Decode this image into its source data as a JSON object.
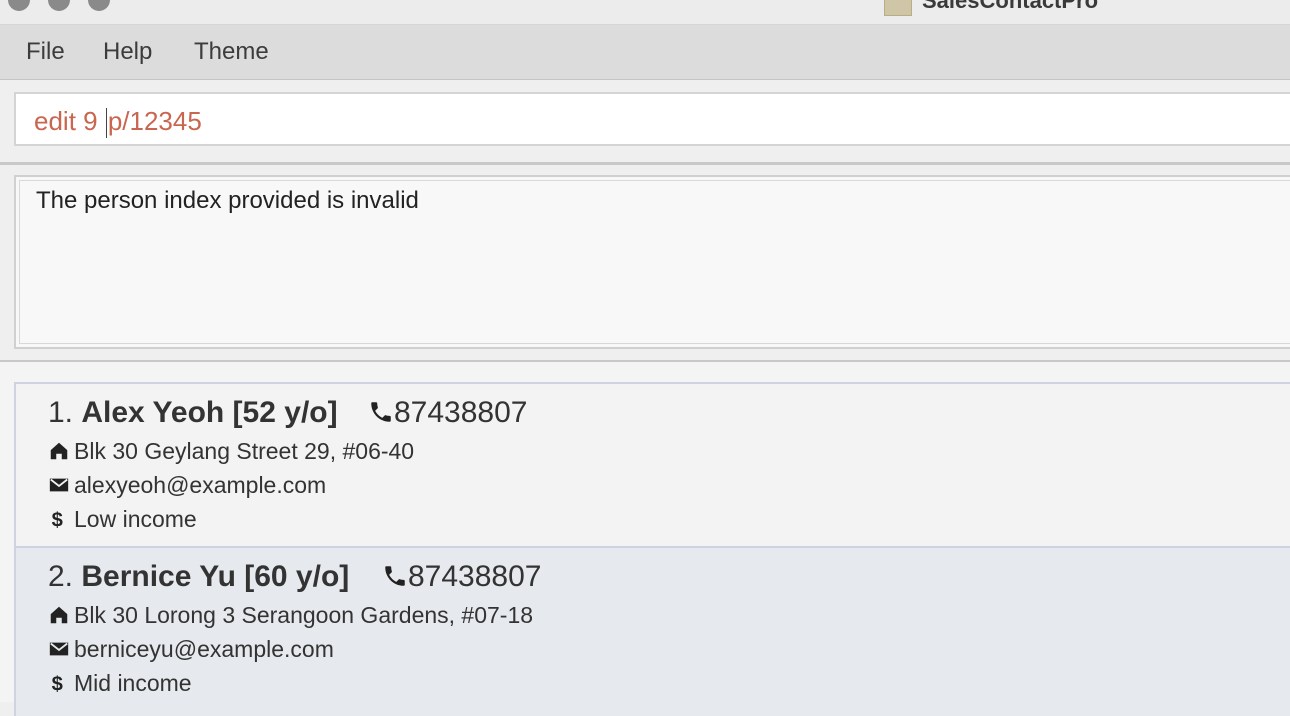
{
  "window": {
    "title": "SalesContactPro"
  },
  "menu": {
    "file": "File",
    "help": "Help",
    "theme": "Theme"
  },
  "command": {
    "value": "edit 9 p/12345"
  },
  "result": {
    "message": "The person index provided is invalid"
  },
  "persons": [
    {
      "index": "1.",
      "name": "Alex Yeoh [52 y/o]",
      "phone": "87438807",
      "address": "Blk 30 Geylang Street 29, #06-40",
      "email": "alexyeoh@example.com",
      "income": "Low income"
    },
    {
      "index": "2.",
      "name": "Bernice Yu [60 y/o]",
      "phone": "87438807",
      "address": "Blk 30 Lorong 3 Serangoon Gardens, #07-18",
      "email": "berniceyu@example.com",
      "income": "Mid income"
    }
  ],
  "icons": {
    "phone": "phone-icon",
    "address": "home-icon",
    "email": "mail-icon",
    "income": "dollar-icon"
  },
  "colors": {
    "command_text": "#c9664f",
    "selected_card": "#e6e9ed"
  }
}
